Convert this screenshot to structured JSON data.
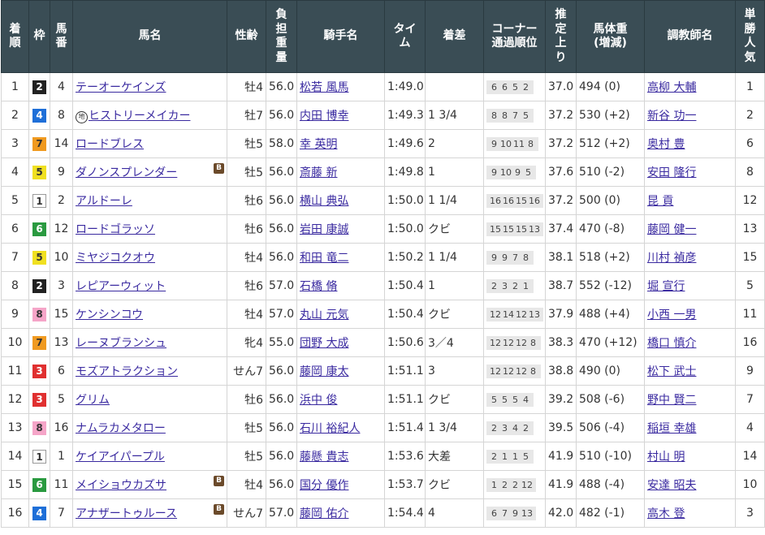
{
  "headers": {
    "rank": "着\n順",
    "waku": "枠",
    "umaban": "馬\n番",
    "horse": "馬名",
    "sexage": "性齢",
    "weight": "負\n担\n重\n量",
    "jockey": "騎手名",
    "time": "タイ\nム",
    "margin": "着差",
    "corner": "コーナー\n通過順位",
    "last": "推\n定\n上\nり",
    "body": "馬体重\n(増減)",
    "trainer": "調教師名",
    "pop": "単\n勝\n人\n気"
  },
  "rows": [
    {
      "rank": "1",
      "waku": "2",
      "umaban": "4",
      "horse": "テーオーケインズ",
      "blinker": "",
      "chi": "",
      "sexage": "牡4",
      "weight": "56.0",
      "jockey": "松若 風馬",
      "time": "1:49.0",
      "margin": "",
      "corner": [
        "6",
        "6",
        "5",
        "2"
      ],
      "last": "37.0",
      "body": "494 (0)",
      "trainer": "高柳 大輔",
      "pop": "1"
    },
    {
      "rank": "2",
      "waku": "4",
      "umaban": "8",
      "horse": "ヒストリーメイカー",
      "blinker": "",
      "chi": "地",
      "sexage": "牡7",
      "weight": "56.0",
      "jockey": "内田 博幸",
      "time": "1:49.3",
      "margin": "1 3/4",
      "corner": [
        "8",
        "8",
        "7",
        "5"
      ],
      "last": "37.2",
      "body": "530 (+2)",
      "trainer": "新谷 功一",
      "pop": "2"
    },
    {
      "rank": "3",
      "waku": "7",
      "umaban": "14",
      "horse": "ロードブレス",
      "blinker": "",
      "chi": "",
      "sexage": "牡5",
      "weight": "58.0",
      "jockey": "幸 英明",
      "time": "1:49.6",
      "margin": "2",
      "corner": [
        "9",
        "10",
        "11",
        "8"
      ],
      "last": "37.2",
      "body": "512 (+2)",
      "trainer": "奥村 豊",
      "pop": "6"
    },
    {
      "rank": "4",
      "waku": "5",
      "umaban": "9",
      "horse": "ダノンスプレンダー",
      "blinker": "B",
      "chi": "",
      "sexage": "牡5",
      "weight": "56.0",
      "jockey": "斎藤 新",
      "time": "1:49.8",
      "margin": "1",
      "corner": [
        "9",
        "10",
        "9",
        "5"
      ],
      "last": "37.6",
      "body": "510 (-2)",
      "trainer": "安田 隆行",
      "pop": "8"
    },
    {
      "rank": "5",
      "waku": "1",
      "umaban": "2",
      "horse": "アルドーレ",
      "blinker": "",
      "chi": "",
      "sexage": "牡6",
      "weight": "56.0",
      "jockey": "横山 典弘",
      "time": "1:50.0",
      "margin": "1 1/4",
      "corner": [
        "16",
        "16",
        "15",
        "16"
      ],
      "last": "37.2",
      "body": "500 (0)",
      "trainer": "昆 貢",
      "pop": "12"
    },
    {
      "rank": "6",
      "waku": "6",
      "umaban": "12",
      "horse": "ロードゴラッソ",
      "blinker": "",
      "chi": "",
      "sexage": "牡6",
      "weight": "56.0",
      "jockey": "岩田 康誠",
      "time": "1:50.0",
      "margin": "クビ",
      "corner": [
        "15",
        "15",
        "15",
        "13"
      ],
      "last": "37.4",
      "body": "470 (-8)",
      "trainer": "藤岡 健一",
      "pop": "13"
    },
    {
      "rank": "7",
      "waku": "5",
      "umaban": "10",
      "horse": "ミヤジコクオウ",
      "blinker": "",
      "chi": "",
      "sexage": "牡4",
      "weight": "56.0",
      "jockey": "和田 竜二",
      "time": "1:50.2",
      "margin": "1 1/4",
      "corner": [
        "9",
        "9",
        "7",
        "8"
      ],
      "last": "38.1",
      "body": "518 (+2)",
      "trainer": "川村 禎彦",
      "pop": "15"
    },
    {
      "rank": "8",
      "waku": "2",
      "umaban": "3",
      "horse": "レピアーウィット",
      "blinker": "",
      "chi": "",
      "sexage": "牡6",
      "weight": "57.0",
      "jockey": "石橋 脩",
      "time": "1:50.4",
      "margin": "1",
      "corner": [
        "2",
        "3",
        "2",
        "1"
      ],
      "last": "38.7",
      "body": "552 (-12)",
      "trainer": "堀 宣行",
      "pop": "5"
    },
    {
      "rank": "9",
      "waku": "8",
      "umaban": "15",
      "horse": "ケンシンコウ",
      "blinker": "",
      "chi": "",
      "sexage": "牡4",
      "weight": "57.0",
      "jockey": "丸山 元気",
      "time": "1:50.4",
      "margin": "クビ",
      "corner": [
        "12",
        "14",
        "12",
        "13"
      ],
      "last": "37.9",
      "body": "488 (+4)",
      "trainer": "小西 一男",
      "pop": "11"
    },
    {
      "rank": "10",
      "waku": "7",
      "umaban": "13",
      "horse": "レーヌブランシュ",
      "blinker": "",
      "chi": "",
      "sexage": "牝4",
      "weight": "55.0",
      "jockey": "団野 大成",
      "time": "1:50.6",
      "margin": "3／4",
      "corner": [
        "12",
        "12",
        "12",
        "8"
      ],
      "last": "38.3",
      "body": "470 (+12)",
      "trainer": "橋口 慎介",
      "pop": "16"
    },
    {
      "rank": "11",
      "waku": "3",
      "umaban": "6",
      "horse": "モズアトラクション",
      "blinker": "",
      "chi": "",
      "sexage": "せん7",
      "weight": "56.0",
      "jockey": "藤岡 康太",
      "time": "1:51.1",
      "margin": "3",
      "corner": [
        "12",
        "12",
        "12",
        "8"
      ],
      "last": "38.8",
      "body": "490 (0)",
      "trainer": "松下 武士",
      "pop": "9"
    },
    {
      "rank": "12",
      "waku": "3",
      "umaban": "5",
      "horse": "グリム",
      "blinker": "",
      "chi": "",
      "sexage": "牡6",
      "weight": "56.0",
      "jockey": "浜中 俊",
      "time": "1:51.1",
      "margin": "クビ",
      "corner": [
        "5",
        "5",
        "5",
        "4"
      ],
      "last": "39.2",
      "body": "508 (-6)",
      "trainer": "野中 賢二",
      "pop": "7"
    },
    {
      "rank": "13",
      "waku": "8",
      "umaban": "16",
      "horse": "ナムラカメタロー",
      "blinker": "",
      "chi": "",
      "sexage": "牡5",
      "weight": "56.0",
      "jockey": "石川 裕紀人",
      "time": "1:51.4",
      "margin": "1 3/4",
      "corner": [
        "2",
        "3",
        "4",
        "2"
      ],
      "last": "39.5",
      "body": "506 (-4)",
      "trainer": "稲垣 幸雄",
      "pop": "4"
    },
    {
      "rank": "14",
      "waku": "1",
      "umaban": "1",
      "horse": "ケイアイパープル",
      "blinker": "",
      "chi": "",
      "sexage": "牡5",
      "weight": "56.0",
      "jockey": "藤懸 貴志",
      "time": "1:53.6",
      "margin": "大差",
      "corner": [
        "2",
        "1",
        "1",
        "5"
      ],
      "last": "41.9",
      "body": "510 (-10)",
      "trainer": "村山 明",
      "pop": "14"
    },
    {
      "rank": "15",
      "waku": "6",
      "umaban": "11",
      "horse": "メイショウカズサ",
      "blinker": "B",
      "chi": "",
      "sexage": "牡4",
      "weight": "56.0",
      "jockey": "国分 優作",
      "time": "1:53.7",
      "margin": "クビ",
      "corner": [
        "1",
        "2",
        "2",
        "12"
      ],
      "last": "41.9",
      "body": "488 (-4)",
      "trainer": "安達 昭夫",
      "pop": "10"
    },
    {
      "rank": "16",
      "waku": "4",
      "umaban": "7",
      "horse": "アナザートゥルース",
      "blinker": "B",
      "chi": "",
      "sexage": "せん7",
      "weight": "57.0",
      "jockey": "藤岡 佑介",
      "time": "1:54.4",
      "margin": "4",
      "corner": [
        "6",
        "7",
        "9",
        "13"
      ],
      "last": "42.0",
      "body": "482 (-1)",
      "trainer": "高木 登",
      "pop": "3"
    }
  ]
}
